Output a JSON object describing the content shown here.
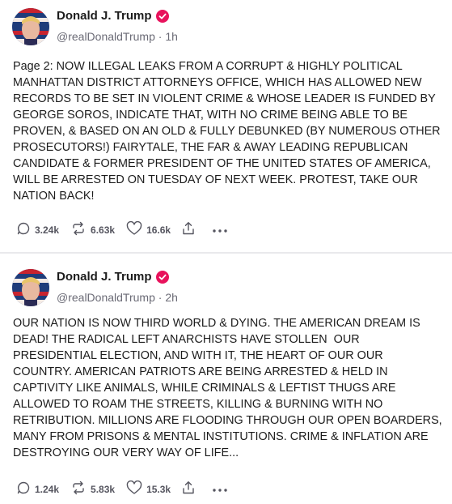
{
  "posts": [
    {
      "author": {
        "name": "Donald J. Trump",
        "handle": "@realDonaldTrump",
        "time": "1h",
        "verified": true
      },
      "text": "Page 2: NOW ILLEGAL LEAKS FROM A CORRUPT & HIGHLY POLITICAL MANHATTAN DISTRICT ATTORNEYS OFFICE, WHICH HAS ALLOWED NEW RECORDS TO BE SET IN VIOLENT CRIME & WHOSE LEADER IS FUNDED BY GEORGE SOROS, INDICATE THAT, WITH NO CRIME BEING ABLE TO BE PROVEN, & BASED ON AN OLD & FULLY DEBUNKED (BY NUMEROUS OTHER PROSECUTORS!) FAIRYTALE, THE FAR & AWAY LEADING REPUBLICAN CANDIDATE & FORMER PRESIDENT OF THE UNITED STATES OF AMERICA, WILL BE ARRESTED ON TUESDAY OF NEXT WEEK. PROTEST, TAKE OUR NATION BACK!",
      "stats": {
        "replies": "3.24k",
        "retruths": "6.63k",
        "likes": "16.6k"
      }
    },
    {
      "author": {
        "name": "Donald J. Trump",
        "handle": "@realDonaldTrump",
        "time": "2h",
        "verified": true
      },
      "text": "OUR NATION IS NOW THIRD WORLD & DYING. THE AMERICAN DREAM IS DEAD! THE RADICAL LEFT ANARCHISTS HAVE STOLLEN  OUR PRESIDENTIAL ELECTION, AND WITH IT, THE HEART OF OUR OUR COUNTRY. AMERICAN PATRIOTS ARE BEING ARRESTED & HELD IN CAPTIVITY LIKE ANIMALS, WHILE CRIMINALS & LEFTIST THUGS ARE ALLOWED TO ROAM THE STREETS, KILLING & BURNING WITH NO RETRIBUTION. MILLIONS ARE FLOODING THROUGH OUR OPEN BOARDERS, MANY FROM PRISONS & MENTAL INSTITUTIONS. CRIME & INFLATION ARE DESTROYING OUR VERY WAY OF LIFE...",
      "stats": {
        "replies": "1.24k",
        "retruths": "5.83k",
        "likes": "15.3k"
      }
    }
  ],
  "separator": " · ",
  "icons": [
    "reply-icon",
    "retruth-icon",
    "like-icon",
    "share-icon",
    "more-icon",
    "verified-badge-icon"
  ],
  "colors": {
    "verified": "#e8125c",
    "text": "#1c1c1c",
    "muted": "#6b6b76",
    "divider": "#e9e9ec"
  }
}
